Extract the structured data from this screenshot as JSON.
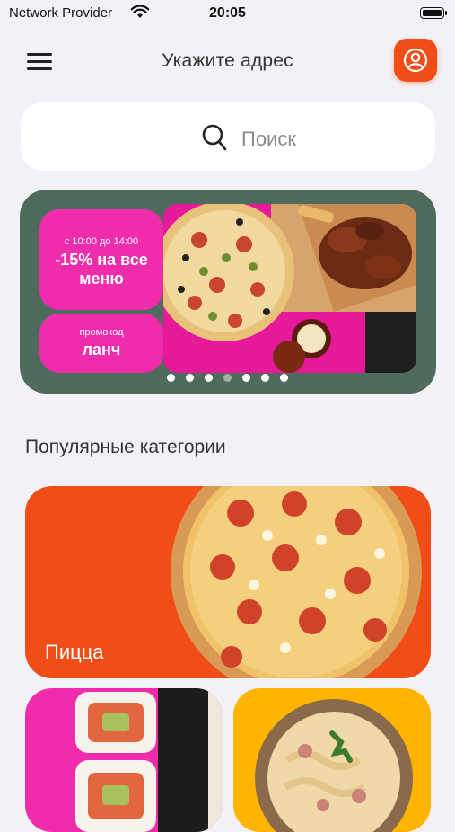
{
  "status_bar": {
    "carrier": "Network Provider",
    "time": "20:05",
    "icons": [
      "wifi-icon",
      "battery-icon"
    ]
  },
  "header": {
    "title": "Укажите адрес",
    "menu_icon": "hamburger-menu-icon",
    "profile_icon": "user-profile-icon",
    "accent": "#f04d17"
  },
  "search": {
    "placeholder": "Поиск",
    "icon": "search-icon"
  },
  "banner": {
    "time_range": "с 10:00 до 14:00",
    "offer": "-15% на все меню",
    "promo_label": "промокод",
    "promo_code": "ланч",
    "slides_count": 7,
    "active_slide": 4,
    "colors": {
      "background": "#4f6b5e",
      "pill": "#ef2cab"
    }
  },
  "popular": {
    "title": "Популярные категории",
    "categories": [
      {
        "label": "Пицца",
        "color": "#f04d17"
      },
      {
        "label": "",
        "color": "#ef2cab"
      },
      {
        "label": "",
        "color": "#ffb400"
      }
    ]
  }
}
